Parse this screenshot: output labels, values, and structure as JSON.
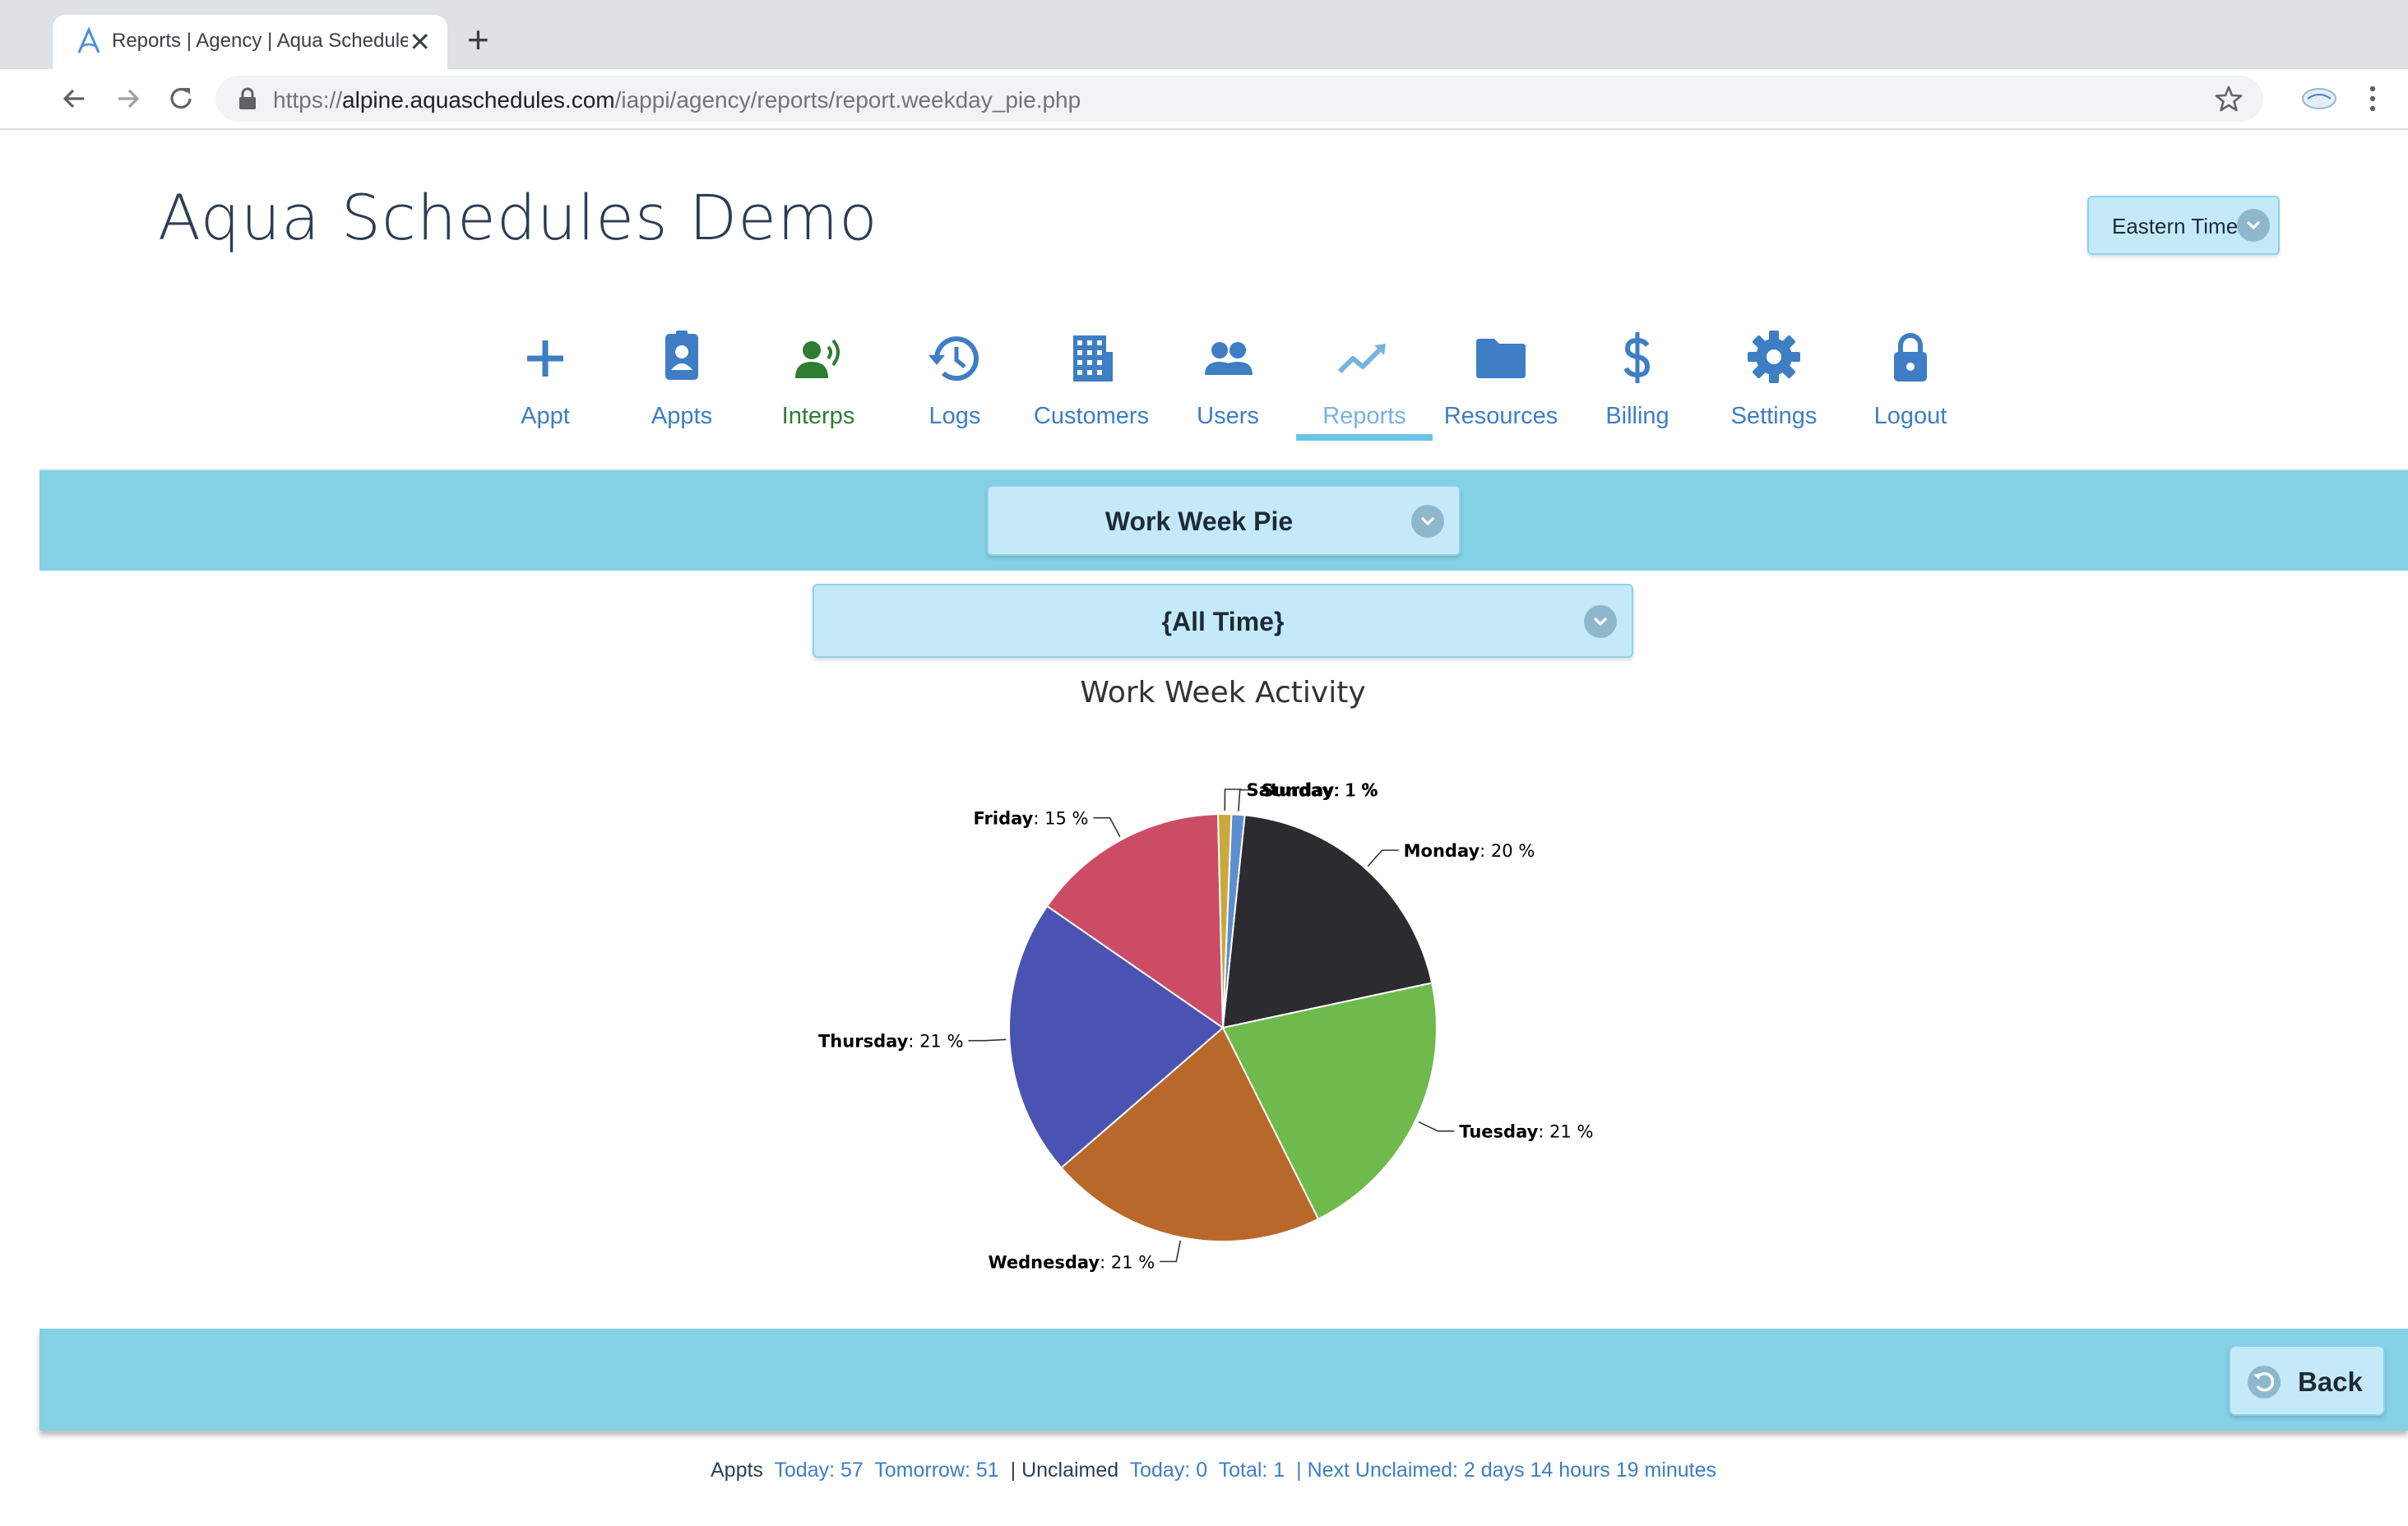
{
  "browser": {
    "tab_title": "Reports | Agency | Aqua Schedules",
    "tab_close": "✕",
    "new_tab": "+",
    "url_scheme": "https://",
    "url_host": "alpine.aquaschedules.com",
    "url_path": "/iappi/agency/reports/report.weekday_pie.php"
  },
  "header": {
    "app_title": "Aqua Schedules Demo",
    "timezone": "Eastern Time"
  },
  "nav": {
    "items": [
      {
        "label": "Appt",
        "icon": "plus-icon"
      },
      {
        "label": "Appts",
        "icon": "id-badge-icon"
      },
      {
        "label": "Interps",
        "icon": "interpreter-icon"
      },
      {
        "label": "Logs",
        "icon": "history-icon"
      },
      {
        "label": "Customers",
        "icon": "building-icon"
      },
      {
        "label": "Users",
        "icon": "users-icon"
      },
      {
        "label": "Reports",
        "icon": "chart-line-icon"
      },
      {
        "label": "Resources",
        "icon": "folder-icon"
      },
      {
        "label": "Billing",
        "icon": "dollar-icon"
      },
      {
        "label": "Settings",
        "icon": "gear-icon"
      },
      {
        "label": "Logout",
        "icon": "lock-icon"
      }
    ],
    "active": "Reports"
  },
  "report": {
    "selected_report": "Work Week Pie",
    "selected_range": "{All Time}"
  },
  "chart_data": {
    "type": "pie",
    "title": "Work Week Activity",
    "unit": "%",
    "slices": [
      {
        "label": "Sunday",
        "value": 1,
        "color": "#5b8fcf"
      },
      {
        "label": "Monday",
        "value": 20,
        "color": "#2b2b30"
      },
      {
        "label": "Tuesday",
        "value": 21,
        "color": "#6fba4c"
      },
      {
        "label": "Wednesday",
        "value": 21,
        "color": "#b9682c"
      },
      {
        "label": "Thursday",
        "value": 21,
        "color": "#4a52b2"
      },
      {
        "label": "Friday",
        "value": 15,
        "color": "#cc4c66"
      },
      {
        "label": "Saturday",
        "value": 1,
        "color": "#c9a93a"
      }
    ]
  },
  "actions": {
    "back_label": "Back"
  },
  "footer": {
    "appts_label": "Appts",
    "today": "Today: 57",
    "tomorrow": "Tomorrow: 51",
    "unclaimed_label": "Unclaimed",
    "unclaimed_today": "Today: 0",
    "unclaimed_total": "Total: 1",
    "next_unclaimed": "Next Unclaimed: 2 days 14 hours 19 minutes"
  },
  "colors": {
    "band": "#84d1e5",
    "select_bg": "#c4eaf9",
    "link": "#3d7ec4",
    "active_nav": "#77b3e0"
  }
}
